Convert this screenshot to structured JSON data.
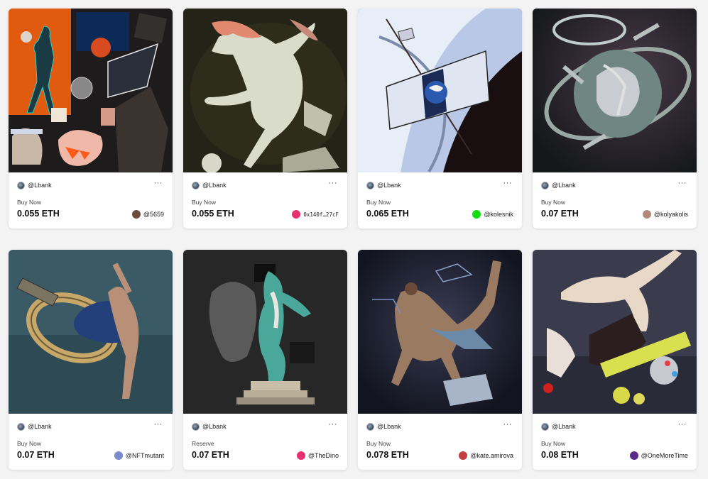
{
  "cards": [
    {
      "creator": "@Lbank",
      "more": "···",
      "status": "Buy Now",
      "price": "0.055 ETH",
      "owner": "@5659",
      "owner_color": "#6a4a3a",
      "art": "collage-orange-figure",
      "mono": false
    },
    {
      "creator": "@Lbank",
      "more": "···",
      "status": "Buy Now",
      "price": "0.055 ETH",
      "owner": "0x140f…27cF",
      "owner_color": "#e6306f",
      "art": "marble-dancer-dark",
      "mono": true
    },
    {
      "creator": "@Lbank",
      "more": "···",
      "status": "Buy Now",
      "price": "0.065 ETH",
      "owner": "@kolesnik",
      "owner_color": "#11dd11",
      "art": "satellite-over-earth",
      "mono": false
    },
    {
      "creator": "@Lbank",
      "more": "···",
      "status": "Buy Now",
      "price": "0.07 ETH",
      "owner": "@kolyakolis",
      "owner_color": "#b08a7a",
      "art": "ringed-space-sculpture",
      "mono": false
    },
    {
      "creator": "@Lbank",
      "more": "···",
      "status": "Buy Now",
      "price": "0.07 ETH",
      "owner": "@NFTmutant",
      "owner_color": "#7a8acc",
      "art": "satellite-ring-blue-figure",
      "mono": false
    },
    {
      "creator": "@Lbank",
      "more": "···",
      "status": "Reserve",
      "price": "0.07 ETH",
      "owner": "@TheDino",
      "owner_color": "#e6306f",
      "art": "fragmented-statue-pedestal",
      "mono": false
    },
    {
      "creator": "@Lbank",
      "more": "···",
      "status": "Buy Now",
      "price": "0.078 ETH",
      "owner": "@kate.amirova",
      "owner_color": "#c04040",
      "art": "floating-man-space",
      "mono": false
    },
    {
      "creator": "@Lbank",
      "more": "···",
      "status": "Buy Now",
      "price": "0.08 ETH",
      "owner": "@OneMoreTime",
      "owner_color": "#5a2a8a",
      "art": "statue-with-candy-spill",
      "mono": false
    }
  ]
}
